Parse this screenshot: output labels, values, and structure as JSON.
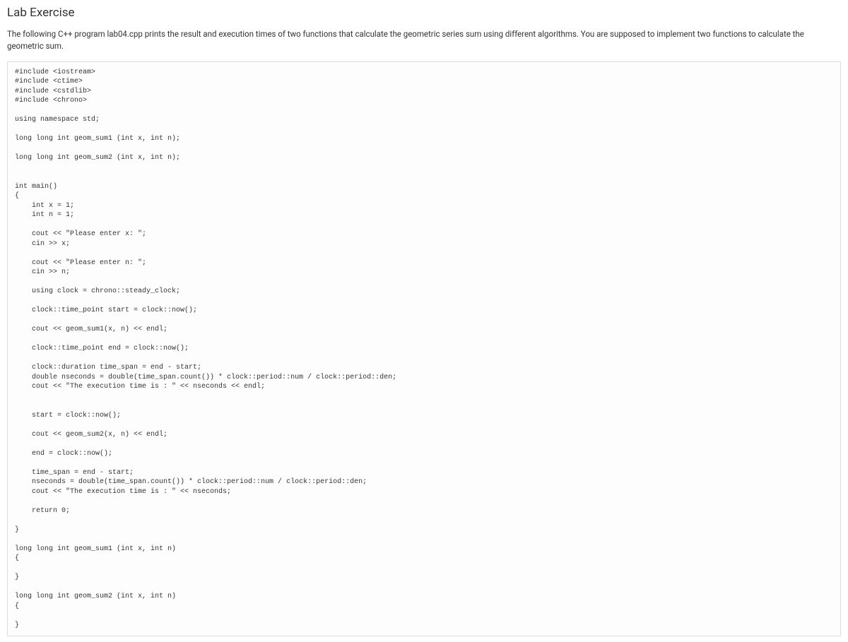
{
  "title": "Lab Exercise",
  "description": "The following C++ program lab04.cpp prints the result and execution times of two functions that calculate the geometric series sum using different algorithms. You are supposed to implement two functions to calculate the geometric sum.",
  "code": "#include <iostream>\n#include <ctime>\n#include <cstdlib>\n#include <chrono>\n\nusing namespace std;\n\nlong long int geom_sum1 (int x, int n);\n\nlong long int geom_sum2 (int x, int n);\n\n\nint main()\n{\n    int x = 1;\n    int n = 1;\n\n    cout << \"Please enter x: \";\n    cin >> x;\n\n    cout << \"Please enter n: \";\n    cin >> n;\n\n    using clock = chrono::steady_clock;\n\n    clock::time_point start = clock::now();\n\n    cout << geom_sum1(x, n) << endl;\n\n    clock::time_point end = clock::now();\n\n    clock::duration time_span = end - start;\n    double nseconds = double(time_span.count()) * clock::period::num / clock::period::den;\n    cout << \"The execution time is : \" << nseconds << endl;\n\n\n    start = clock::now();\n\n    cout << geom_sum2(x, n) << endl;\n\n    end = clock::now();\n\n    time_span = end - start;\n    nseconds = double(time_span.count()) * clock::period::num / clock::period::den;\n    cout << \"The execution time is : \" << nseconds;\n\n    return 0;\n\n}\n\nlong long int geom_sum1 (int x, int n)\n{\n\n}\n\nlong long int geom_sum2 (int x, int n)\n{\n\n}"
}
